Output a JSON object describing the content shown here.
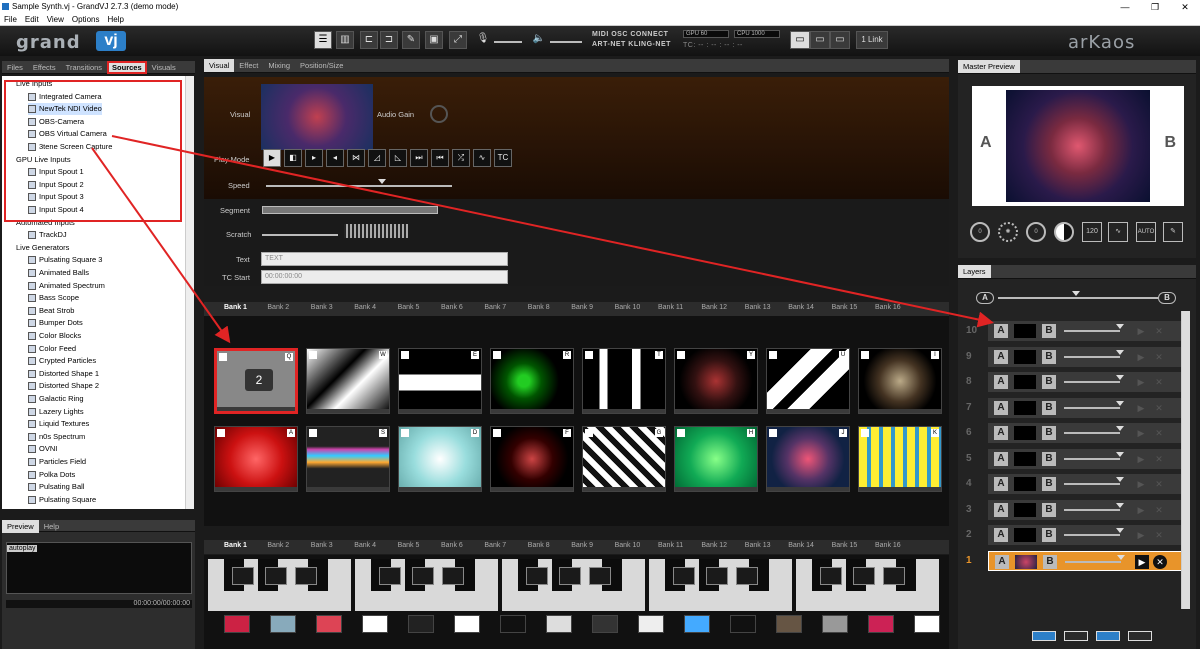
{
  "titlebar": {
    "title": "Sample Synth.vj - GrandVJ 2.7.3  (demo mode)",
    "min": "—",
    "max": "❐",
    "close": "✕"
  },
  "menu": [
    "File",
    "Edit",
    "View",
    "Options",
    "Help"
  ],
  "toolbar": {
    "logo_left1": "grand",
    "logo_left2": "vj",
    "logo_right": "arKaos",
    "midi_line1": "MIDI  OSC  CONNECT",
    "midi_line2": "ART-NET KLING-NET",
    "gpu": "GPU 60",
    "cpu": "CPU 1000",
    "tc": "TC: -- : -- : -- : --",
    "link": "1 Link"
  },
  "left_tabs": [
    "Files",
    "Effects",
    "Transitions",
    "Sources",
    "Visuals"
  ],
  "tree": [
    {
      "t": "Live Inputs",
      "lvl": 0
    },
    {
      "t": "Integrated Camera",
      "lvl": 1
    },
    {
      "t": "NewTek NDI Video",
      "lvl": 1,
      "sel": true
    },
    {
      "t": "OBS-Camera",
      "lvl": 1
    },
    {
      "t": "OBS Virtual Camera",
      "lvl": 1
    },
    {
      "t": "3tene Screen Capture",
      "lvl": 1
    },
    {
      "t": "GPU Live Inputs",
      "lvl": 0
    },
    {
      "t": "Input Spout 1",
      "lvl": 1
    },
    {
      "t": "Input Spout 2",
      "lvl": 1
    },
    {
      "t": "Input Spout 3",
      "lvl": 1
    },
    {
      "t": "Input Spout 4",
      "lvl": 1
    },
    {
      "t": "Automated Inputs",
      "lvl": 0
    },
    {
      "t": "TrackDJ",
      "lvl": 1
    },
    {
      "t": "Live Generators",
      "lvl": 0
    },
    {
      "t": "Pulsating Square 3",
      "lvl": 1
    },
    {
      "t": "Animated Balls",
      "lvl": 1
    },
    {
      "t": "Animated Spectrum",
      "lvl": 1
    },
    {
      "t": "Bass Scope",
      "lvl": 1
    },
    {
      "t": "Beat Strob",
      "lvl": 1
    },
    {
      "t": "Bumper Dots",
      "lvl": 1
    },
    {
      "t": "Color Blocks",
      "lvl": 1
    },
    {
      "t": "Color Feed",
      "lvl": 1
    },
    {
      "t": "Crypted Particles",
      "lvl": 1
    },
    {
      "t": "Distorted Shape 1",
      "lvl": 1
    },
    {
      "t": "Distorted Shape 2",
      "lvl": 1
    },
    {
      "t": "Galactic Ring",
      "lvl": 1
    },
    {
      "t": "Lazery Lights",
      "lvl": 1
    },
    {
      "t": "Liquid Textures",
      "lvl": 1
    },
    {
      "t": "n0s Spectrum",
      "lvl": 1
    },
    {
      "t": "OVNI",
      "lvl": 1
    },
    {
      "t": "Particles Field",
      "lvl": 1
    },
    {
      "t": "Polka Dots",
      "lvl": 1
    },
    {
      "t": "Pulsating Ball",
      "lvl": 1
    },
    {
      "t": "Pulsating Square",
      "lvl": 1
    }
  ],
  "preview": {
    "tabs": [
      "Preview",
      "Help"
    ],
    "autoplay": "autoplay",
    "time": "00:00:00/00:00:00"
  },
  "visual": {
    "tabs": [
      "Visual",
      "Effect",
      "Mixing",
      "Position/Size"
    ],
    "visual_label": "Visual",
    "audio_gain": "Audio Gain",
    "play_mode": "Play Mode",
    "speed": "Speed",
    "segment": "Segment",
    "scratch": "Scratch",
    "text_label": "Text",
    "text_placeholder": "TEXT",
    "tc_start": "TC Start",
    "tc_value": "00:00:00:00",
    "tc_btn": "TC"
  },
  "banks": [
    "Bank 1",
    "Bank 2",
    "Bank 3",
    "Bank 4",
    "Bank 5",
    "Bank 6",
    "Bank 7",
    "Bank 8",
    "Bank 9",
    "Bank 10",
    "Bank 11",
    "Bank 12",
    "Bank 13",
    "Bank 14",
    "Bank 15",
    "Bank 16"
  ],
  "clips_row1": [
    {
      "key": "Q",
      "style": "camera",
      "num": "2"
    },
    {
      "key": "W",
      "style": "poly"
    },
    {
      "key": "E",
      "style": "whitebar"
    },
    {
      "key": "R",
      "style": "greendots"
    },
    {
      "key": "T",
      "style": "pixels"
    },
    {
      "key": "Y",
      "style": "eye"
    },
    {
      "key": "U",
      "style": "chevron"
    },
    {
      "key": "I",
      "style": "sparkle"
    }
  ],
  "clips_row2": [
    {
      "key": "A",
      "style": "redswirl"
    },
    {
      "key": "S",
      "style": "streaks"
    },
    {
      "key": "D",
      "style": "swirl"
    },
    {
      "key": "F",
      "style": "circuit"
    },
    {
      "key": "G",
      "style": "triangles"
    },
    {
      "key": "H",
      "style": "greenswirl"
    },
    {
      "key": "J",
      "style": "tunnel"
    },
    {
      "key": "K",
      "style": "yellowgrid"
    }
  ],
  "master": {
    "title": "Master Preview",
    "a": "A",
    "b": "B",
    "bpm": "120",
    "auto": "AUTO"
  },
  "layers": {
    "title": "Layers",
    "a": "A",
    "b": "B",
    "rows": [
      "10",
      "9",
      "8",
      "7",
      "6",
      "5",
      "4",
      "3",
      "2",
      "1"
    ]
  },
  "colors": {
    "accent": "#e8942a",
    "red": "#e02424",
    "blue": "#2c7fc8"
  }
}
